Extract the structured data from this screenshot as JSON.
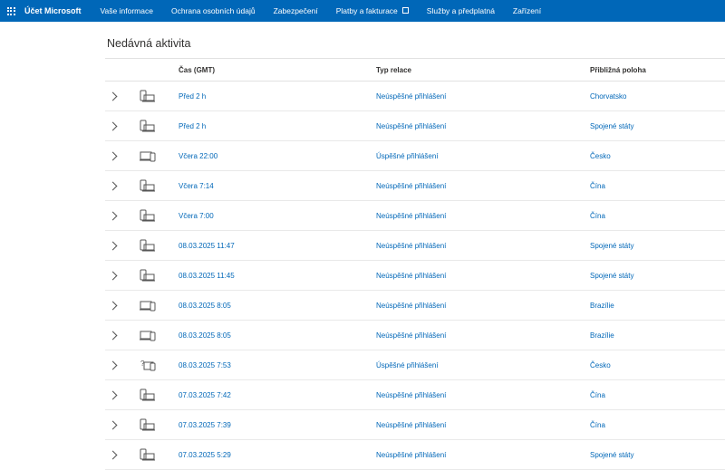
{
  "topbar": {
    "brand": "Účet Microsoft",
    "nav": [
      {
        "label": "Vaše informace"
      },
      {
        "label": "Ochrana osobních údajů"
      },
      {
        "label": "Zabezpečení"
      },
      {
        "label": "Platby a fakturace",
        "external": true
      },
      {
        "label": "Služby a předplatná"
      },
      {
        "label": "Zařízení"
      }
    ]
  },
  "page": {
    "heading": "Nedávná aktivita"
  },
  "table": {
    "columns": {
      "time": "Čas (GMT)",
      "type": "Typ relace",
      "location": "Přibližná poloha"
    },
    "rows": [
      {
        "device": "phone-desktop-icon",
        "time": "Před 2 h",
        "type": "Neúspěšné přihlášení",
        "location": "Chorvatsko"
      },
      {
        "device": "phone-desktop-icon",
        "time": "Před 2 h",
        "type": "Neúspěšné přihlášení",
        "location": "Spojené státy"
      },
      {
        "device": "laptop-phone-icon",
        "time": "Včera 22:00",
        "type": "Úspěšné přihlášení",
        "location": "Česko"
      },
      {
        "device": "phone-desktop-icon",
        "time": "Včera 7:14",
        "type": "Neúspěšné přihlášení",
        "location": "Čína"
      },
      {
        "device": "phone-desktop-icon",
        "time": "Včera 7:00",
        "type": "Neúspěšné přihlášení",
        "location": "Čína"
      },
      {
        "device": "phone-desktop-icon",
        "time": "08.03.2025 11:47",
        "type": "Neúspěšné přihlášení",
        "location": "Spojené státy"
      },
      {
        "device": "phone-desktop-icon",
        "time": "08.03.2025 11:45",
        "type": "Neúspěšné přihlášení",
        "location": "Spojené státy"
      },
      {
        "device": "laptop-phone-icon",
        "time": "08.03.2025 8:05",
        "type": "Neúspěšné přihlášení",
        "location": "Brazílie"
      },
      {
        "device": "laptop-phone-icon",
        "time": "08.03.2025 8:05",
        "type": "Neúspěšné přihlášení",
        "location": "Brazílie"
      },
      {
        "device": "unknown-device-icon",
        "time": "08.03.2025 7:53",
        "type": "Úspěšné přihlášení",
        "location": "Česko"
      },
      {
        "device": "phone-desktop-icon",
        "time": "07.03.2025 7:42",
        "type": "Neúspěšné přihlášení",
        "location": "Čína"
      },
      {
        "device": "phone-desktop-icon",
        "time": "07.03.2025 7:39",
        "type": "Neúspěšné přihlášení",
        "location": "Čína"
      },
      {
        "device": "phone-desktop-icon",
        "time": "07.03.2025 5:29",
        "type": "Neúspěšné přihlášení",
        "location": "Spojené státy"
      }
    ]
  }
}
